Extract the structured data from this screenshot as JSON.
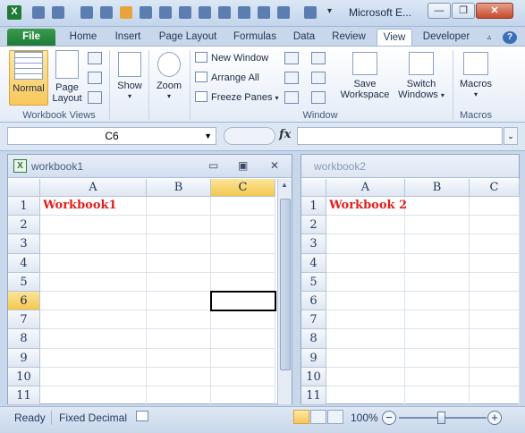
{
  "window": {
    "title": "Microsoft E...",
    "min_glyph": "—",
    "restore_glyph": "❐",
    "close_glyph": "✕"
  },
  "tabs": [
    "File",
    "Home",
    "Insert",
    "Page Layout",
    "Formulas",
    "Data",
    "Review",
    "View",
    "Developer"
  ],
  "active_tab": "View",
  "ribbon": {
    "workbook_views": {
      "label": "Workbook Views",
      "normal": "Normal",
      "page_layout_1": "Page",
      "page_layout_2": "Layout"
    },
    "show": "Show",
    "zoom": "Zoom",
    "window": {
      "label": "Window",
      "new_window": "New Window",
      "arrange_all": "Arrange All",
      "freeze_panes": "Freeze Panes",
      "save_ws_1": "Save",
      "save_ws_2": "Workspace",
      "switch_1": "Switch",
      "switch_2": "Windows"
    },
    "macros": {
      "label": "Macros",
      "button": "Macros"
    }
  },
  "formula_bar": {
    "name_box": "C6",
    "fx": "fx",
    "value": ""
  },
  "workbook1": {
    "title": "workbook1",
    "columns": [
      "A",
      "B",
      "C"
    ],
    "rows": [
      "1",
      "2",
      "3",
      "4",
      "5",
      "6",
      "7",
      "8",
      "9",
      "10",
      "11"
    ],
    "a1": "Workbook1",
    "selected_column": "C",
    "selected_row": "6",
    "active_cell": "C6"
  },
  "workbook2": {
    "title": "workbook2",
    "columns": [
      "A",
      "B",
      "C"
    ],
    "rows": [
      "1",
      "2",
      "3",
      "4",
      "5",
      "6",
      "7",
      "8",
      "9",
      "10",
      "11"
    ],
    "a1": "Workbook 2"
  },
  "status_bar": {
    "ready": "Ready",
    "mode": "Fixed Decimal",
    "zoom": "100%",
    "zoom_minus": "−",
    "zoom_plus": "+"
  },
  "colors": {
    "cell_text": "#e02020",
    "accent_green": "#1f7a35",
    "selection": "#f4c74f"
  }
}
